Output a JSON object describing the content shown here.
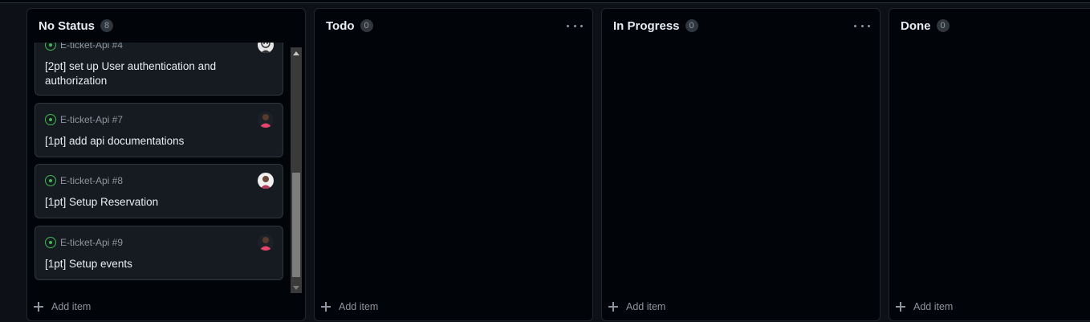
{
  "columns": [
    {
      "title": "No Status",
      "count": "8",
      "add_label": "Add item",
      "cards": [
        {
          "ref": "E-ticket-Api #4",
          "title": "[2pt] set up User authentication and authorization"
        },
        {
          "ref": "E-ticket-Api #7",
          "title": "[1pt] add api documentations"
        },
        {
          "ref": "E-ticket-Api #8",
          "title": "[1pt] Setup Reservation"
        },
        {
          "ref": "E-ticket-Api #9",
          "title": "[1pt] Setup events"
        }
      ]
    },
    {
      "title": "Todo",
      "count": "0",
      "add_label": "Add item"
    },
    {
      "title": "In Progress",
      "count": "0",
      "add_label": "Add item"
    },
    {
      "title": "Done",
      "count": "0",
      "add_label": "Add item"
    }
  ],
  "colors": {
    "background": "#0d1117",
    "column_bg": "#010409",
    "card_bg": "#161b22",
    "issue_open": "#3fb950",
    "muted_text": "#8d96a0"
  },
  "icons": {
    "issue_status": "issue-opened-icon",
    "column_menu": "kebab-horizontal-icon",
    "add": "plus-icon"
  }
}
